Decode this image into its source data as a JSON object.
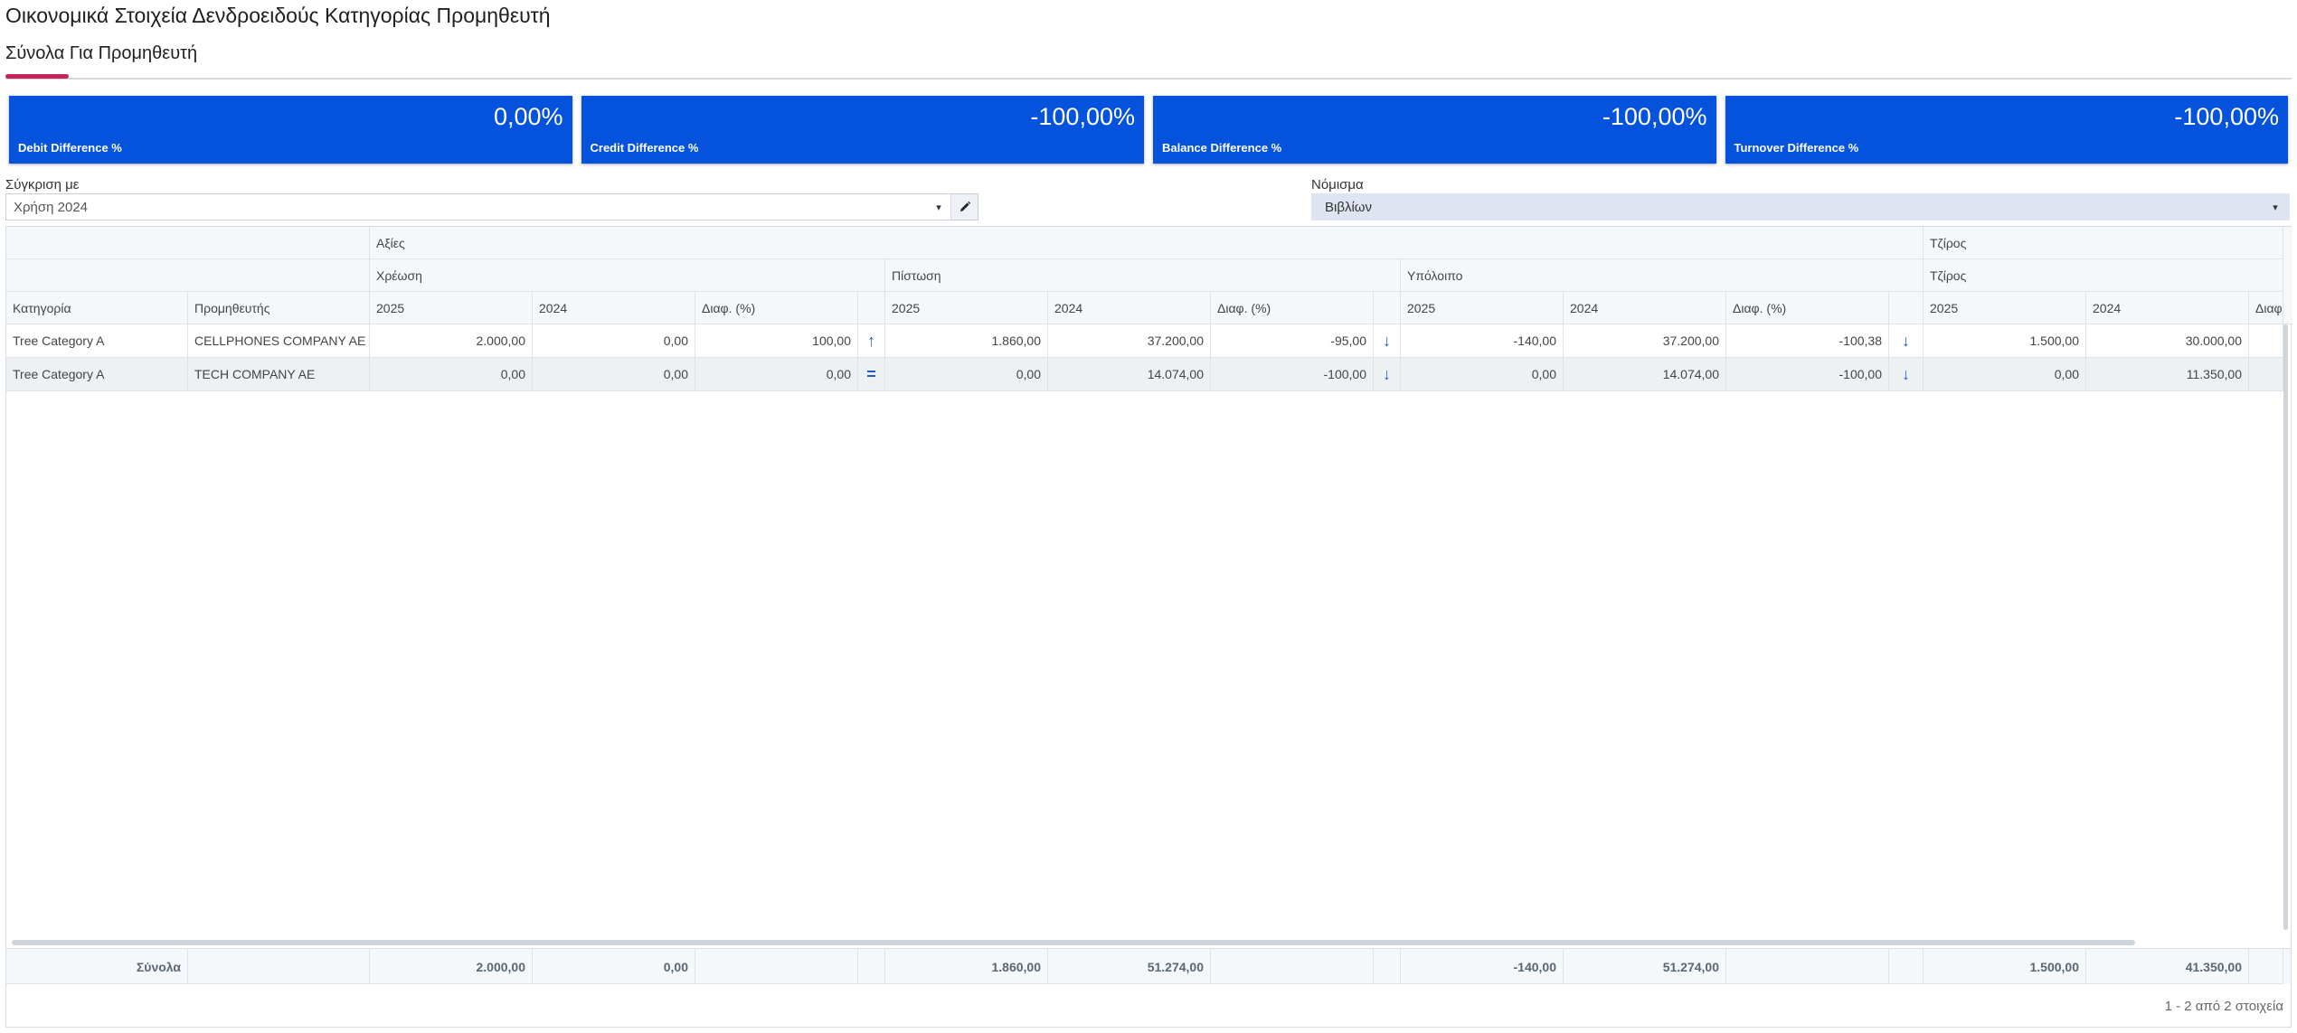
{
  "page": {
    "title": "Οικονομικά Στοιχεία Δενδροειδούς Κατηγορίας Προμηθευτή"
  },
  "tabs": [
    {
      "label": "Σύνολα Για Προμηθευτή",
      "active": true
    }
  ],
  "kpis": [
    {
      "label": "Debit Difference %",
      "value": "0,00%"
    },
    {
      "label": "Credit Difference %",
      "value": "-100,00%"
    },
    {
      "label": "Balance Difference %",
      "value": "-100,00%"
    },
    {
      "label": "Turnover Difference %",
      "value": "-100,00%"
    }
  ],
  "filters": {
    "compare": {
      "label": "Σύγκριση με",
      "value": "Χρήση 2024"
    },
    "currency": {
      "label": "Νόμισμα",
      "value": "Βιβλίων"
    }
  },
  "grid": {
    "band_headers": {
      "values": "Αξίες",
      "turnover": "Τζίρος"
    },
    "group_headers": {
      "debit": "Χρέωση",
      "credit": "Πίστωση",
      "balance": "Υπόλοιπο",
      "turnover": "Τζίρος"
    },
    "columns": {
      "category": "Κατηγορία",
      "supplier": "Προμηθευτής",
      "year_current": "2025",
      "year_previous": "2024",
      "diff_pct": "Διαφ. (%)"
    },
    "rows": [
      {
        "category": "Tree Category A",
        "supplier": "CELLPHONES COMPANY AE",
        "debit": {
          "current": "2.000,00",
          "previous": "0,00",
          "diff": "100,00",
          "trend": "up"
        },
        "credit": {
          "current": "1.860,00",
          "previous": "37.200,00",
          "diff": "-95,00",
          "trend": "down"
        },
        "balance": {
          "current": "-140,00",
          "previous": "37.200,00",
          "diff": "-100,38",
          "trend": "down"
        },
        "turnover": {
          "current": "1.500,00",
          "previous": "30.000,00"
        }
      },
      {
        "category": "Tree Category A",
        "supplier": "TECH COMPANY AE",
        "debit": {
          "current": "0,00",
          "previous": "0,00",
          "diff": "0,00",
          "trend": "equal"
        },
        "credit": {
          "current": "0,00",
          "previous": "14.074,00",
          "diff": "-100,00",
          "trend": "down"
        },
        "balance": {
          "current": "0,00",
          "previous": "14.074,00",
          "diff": "-100,00",
          "trend": "down"
        },
        "turnover": {
          "current": "0,00",
          "previous": "11.350,00"
        }
      }
    ],
    "totals": {
      "label": "Σύνολα",
      "debit": {
        "current": "2.000,00",
        "previous": "0,00"
      },
      "credit": {
        "current": "1.860,00",
        "previous": "51.274,00"
      },
      "balance": {
        "current": "-140,00",
        "previous": "51.274,00"
      },
      "turnover": {
        "current": "1.500,00",
        "previous": "41.350,00"
      }
    },
    "pager_text": "1 - 2 από 2 στοιχεία"
  },
  "icons": {
    "trend_up": "↑",
    "trend_down": "↓",
    "trend_equal": "=",
    "caret": "▾",
    "pencil": "✎"
  },
  "colors": {
    "kpi_background": "#0553dd",
    "tab_indicator": "#c8245c",
    "trend_arrow": "#1e5bd8"
  }
}
